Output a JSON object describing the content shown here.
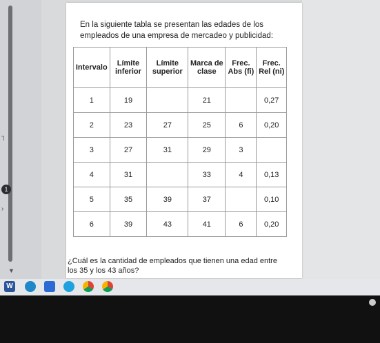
{
  "intro": "En la siguiente tabla se presentan las edades de los empleados de una empresa de mercadeo y publicidad:",
  "table": {
    "headers": [
      "Intervalo",
      "Límite inferior",
      "Límite superior",
      "Marca de clase",
      "Frec. Abs (fi)",
      "Frec. Rel (ni)"
    ],
    "rows": [
      [
        "1",
        "19",
        "",
        "21",
        "",
        "0,27"
      ],
      [
        "2",
        "23",
        "27",
        "25",
        "6",
        "0,20"
      ],
      [
        "3",
        "27",
        "31",
        "29",
        "3",
        ""
      ],
      [
        "4",
        "31",
        "",
        "33",
        "4",
        "0,13"
      ],
      [
        "5",
        "35",
        "39",
        "37",
        "",
        "0,10"
      ],
      [
        "6",
        "39",
        "43",
        "41",
        "6",
        "0,20"
      ]
    ]
  },
  "question": "¿Cuál es la cantidad de empleados que tienen una edad entre los 35 y los 43 años?",
  "side_badge": "1",
  "taskbar": {
    "icons": [
      "word-icon",
      "edge-icon",
      "folder-icon",
      "skype-icon",
      "chrome-icon",
      "chrome-icon"
    ],
    "word_letter": "W"
  }
}
